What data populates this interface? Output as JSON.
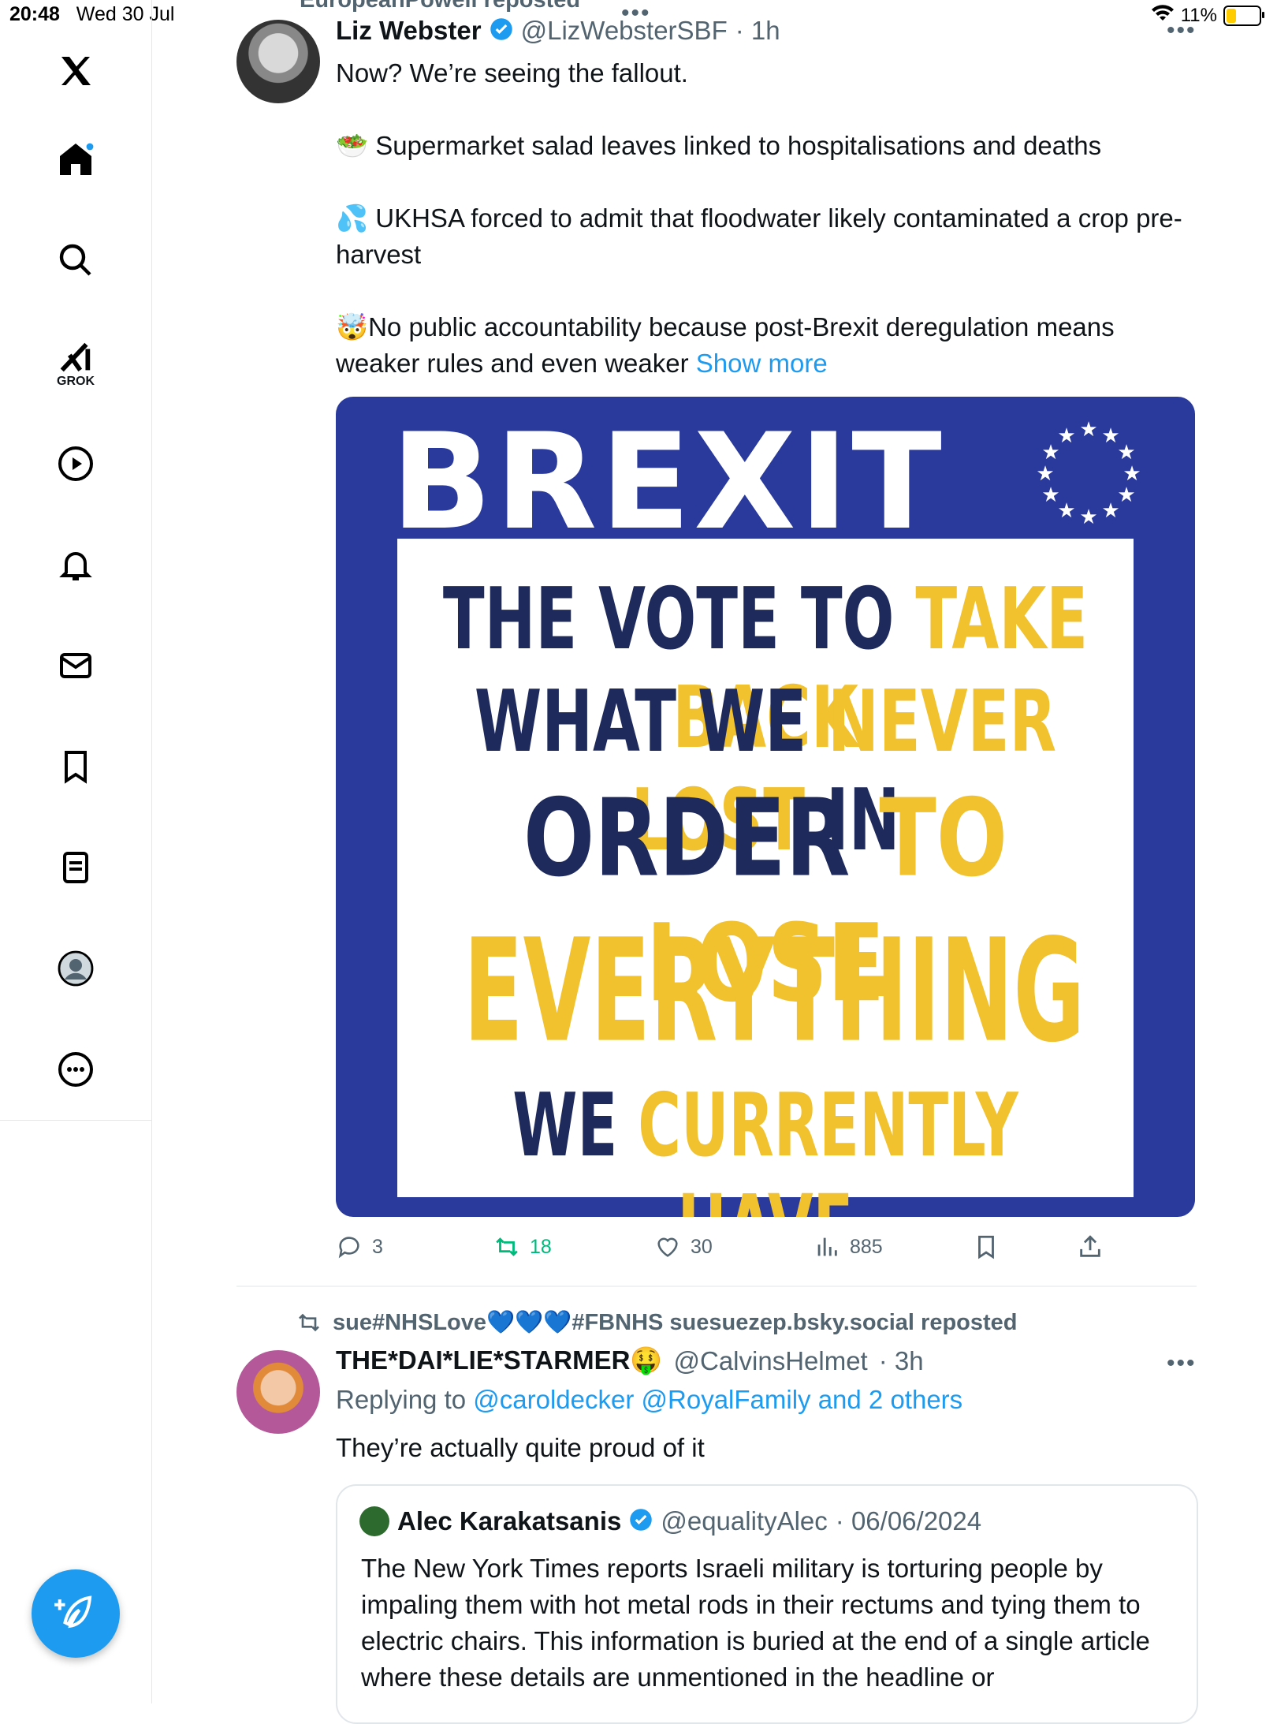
{
  "status": {
    "time": "20:48",
    "date": "Wed 30 Jul",
    "battery": "11%",
    "battery_level": 0.11
  },
  "sidebar": {
    "grok_label": "GROK",
    "items": [
      "x-logo",
      "home",
      "search",
      "grok",
      "video",
      "notifications",
      "messages",
      "bookmarks",
      "lists",
      "profile",
      "more"
    ]
  },
  "tweet1": {
    "reposted_by": "EuropeanPowell reposted",
    "name": "Liz Webster",
    "handle": "@LizWebsterSBF",
    "time": "· 1h",
    "line1": "Now? We’re seeing the fallout.",
    "line2": "🥗 Supermarket salad leaves linked to hospitalisations and deaths",
    "line3": "💦 UKHSA forced to admit that floodwater likely contaminated a crop pre-harvest",
    "line4": "🤯No public accountability because post-Brexit deregulation means weaker rules and even weaker",
    "show_more": "Show more",
    "image": {
      "title": "BREXIT",
      "line1a": "THE VOTE TO ",
      "line1b": "TAKE BACK",
      "line2a": "WHAT WE ",
      "line2b": "NEVER LOST",
      "line2c": " IN",
      "line3a": "ORDER ",
      "line3b": "TO LOSE",
      "line4": "EVERYTHING",
      "line5a": "WE ",
      "line5b": "CURRENTLY HAVE"
    },
    "actions": {
      "replies": "3",
      "reposts": "18",
      "likes": "30",
      "views": "885"
    }
  },
  "tweet2": {
    "reposted_by": "sue#NHSLove💙💙💙#FBNHS suesuezep.bsky.social reposted",
    "name": "THE*DAI*LIE*STARMER🤑",
    "handle": "@CalvinsHelmet",
    "time": "· 3h",
    "replying_prefix": "Replying to ",
    "replying_to": "@caroldecker @RoyalFamily and 2 others",
    "text": "They’re actually quite proud of it",
    "quote": {
      "name": "Alec Karakatsanis",
      "handle": "@equalityAlec",
      "date": "· 06/06/2024",
      "text": "The New York Times reports Israeli military is torturing people by impaling them with hot metal rods in their rectums and tying them to electric chairs. This information is buried at the end of a single article where these details are unmentioned in the headline or"
    }
  },
  "colors": {
    "accent": "#1d9bf0",
    "repost_green": "#00ba7c",
    "image_blue": "#2a3a9c",
    "image_yellow": "#f2c12e",
    "image_navy": "#1f2a5c"
  }
}
